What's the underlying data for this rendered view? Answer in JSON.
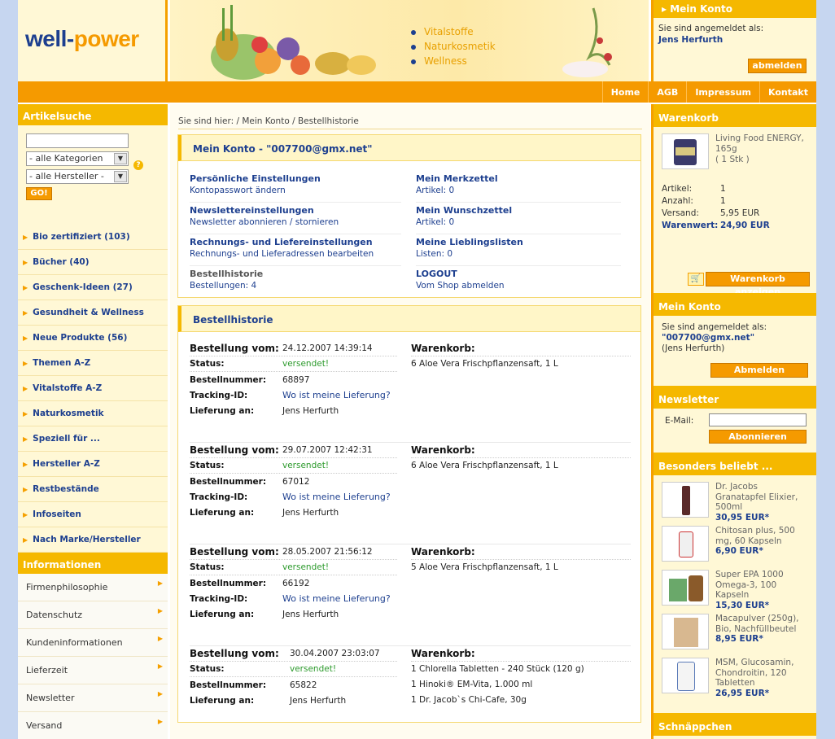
{
  "logo": {
    "part1": "well-",
    "part2": "power"
  },
  "banner": {
    "items": [
      "Vitalstoffe",
      "Naturkosmetik",
      "Wellness"
    ]
  },
  "top_account": {
    "title": "Mein Konto",
    "logged_in_as": "Sie sind angemeldet als:",
    "user": "Jens Herfurth",
    "logout": "abmelden"
  },
  "nav": {
    "items": [
      "Home",
      "AGB",
      "Impressum",
      "Kontakt"
    ]
  },
  "search": {
    "title": "Artikelsuche",
    "query": "",
    "help": "?",
    "category": "- alle Kategorien",
    "maker": "- alle Hersteller -",
    "go": "GO!"
  },
  "categories": [
    "Bio zertifiziert (103)",
    "Bücher (40)",
    "Geschenk-Ideen (27)",
    "Gesundheit & Wellness",
    "Neue Produkte (56)",
    "Themen A-Z",
    "Vitalstoffe A-Z",
    "Naturkosmetik",
    "Speziell für ...",
    "Hersteller A-Z",
    "Restbestände",
    "Infoseiten",
    "Nach Marke/Hersteller"
  ],
  "informations": {
    "title": "Informationen",
    "items": [
      "Firmenphilosophie",
      "Datenschutz",
      "Kundeninformationen",
      "Lieferzeit",
      "Newsletter",
      "Versand",
      ""
    ]
  },
  "breadcrumb": "Sie sind hier: / Mein Konto / Bestellhistorie",
  "account": {
    "title": "Mein Konto - \"007700@gmx.net\"",
    "items": [
      {
        "title": "Persönliche Einstellungen",
        "sub": "Kontopasswort ändern"
      },
      {
        "title": "Mein Merkzettel",
        "sub": "Artikel: 0"
      },
      {
        "title": "Newslettereinstellungen",
        "sub": "Newsletter abonnieren / stornieren"
      },
      {
        "title": "Mein Wunschzettel",
        "sub": "Artikel: 0"
      },
      {
        "title": "Rechnungs- und Liefereinstellungen",
        "sub": "Rechnungs- und Lieferadressen bearbeiten"
      },
      {
        "title": "Meine Lieblingslisten",
        "sub": "Listen: 0"
      },
      {
        "title": "Bestellhistorie",
        "sub": "Bestellungen: 4"
      },
      {
        "title": "LOGOUT",
        "sub": "Vom Shop abmelden"
      }
    ]
  },
  "history": {
    "title": "Bestellhistorie",
    "labels": {
      "date": "Bestellung vom:",
      "status": "Status:",
      "number": "Bestellnummer:",
      "tracking": "Tracking-ID:",
      "delivery": "Lieferung an:",
      "cart": "Warenkorb:"
    },
    "orders": [
      {
        "date": "24.12.2007 14:39:14",
        "status": "versendet!",
        "number": "68897",
        "tracking": "Wo ist meine Lieferung?",
        "delivery": "Jens Herfurth",
        "items": [
          "6  Aloe Vera Frischpflanzensaft, 1 L"
        ]
      },
      {
        "date": "29.07.2007 12:42:31",
        "status": "versendet!",
        "number": "67012",
        "tracking": "Wo ist meine Lieferung?",
        "delivery": "Jens Herfurth",
        "items": [
          "6  Aloe Vera Frischpflanzensaft, 1 L"
        ]
      },
      {
        "date": "28.05.2007 21:56:12",
        "status": "versendet!",
        "number": "66192",
        "tracking": "Wo ist meine Lieferung?",
        "delivery": "Jens Herfurth",
        "items": [
          "5  Aloe Vera Frischpflanzensaft, 1 L"
        ]
      },
      {
        "date": "30.04.2007 23:03:07",
        "status": "versendet!",
        "number": "65822",
        "delivery": "Jens Herfurth",
        "items": [
          "1  Chlorella Tabletten - 240 Stück (120 g)",
          "1  Hinoki® EM-Vita, 1.000 ml",
          "1  Dr. Jacob`s Chi-Cafe, 30g"
        ]
      }
    ]
  },
  "cart": {
    "title": "Warenkorb",
    "product": "Living Food ENERGY, 165g",
    "qty": "( 1 Stk )",
    "rows": [
      [
        "Artikel:",
        "1"
      ],
      [
        "Anzahl:",
        "1"
      ],
      [
        "Versand:",
        "5,95 EUR"
      ],
      [
        "Warenwert:",
        "24,90 EUR"
      ]
    ],
    "button": "Warenkorb anzeigen"
  },
  "account_box": {
    "title": "Mein Konto",
    "logged_in_as": "Sie sind angemeldet als:",
    "email": "\"007700@gmx.net\"",
    "name": "(Jens Herfurth)",
    "button": "Abmelden"
  },
  "newsletter": {
    "title": "Newsletter",
    "label": "E-Mail:",
    "value": "",
    "button": "Abonnieren"
  },
  "popular": {
    "title": "Besonders beliebt ...",
    "items": [
      {
        "name": "Dr. Jacobs Granatapfel Elixier, 500ml",
        "price": "30,95 EUR*"
      },
      {
        "name": "Chitosan plus, 500 mg, 60 Kapseln",
        "price": "6,90 EUR*"
      },
      {
        "name": "Super EPA 1000 Omega-3, 100 Kapseln",
        "price": "15,30 EUR*"
      },
      {
        "name": "Macapulver (250g), Bio, Nachfüllbeutel",
        "price": "8,95 EUR*"
      },
      {
        "name": "MSM, Glucosamin, Chondroitin, 120 Tabletten",
        "price": "26,95 EUR*"
      }
    ]
  },
  "bargains": {
    "title": "Schnäppchen"
  }
}
